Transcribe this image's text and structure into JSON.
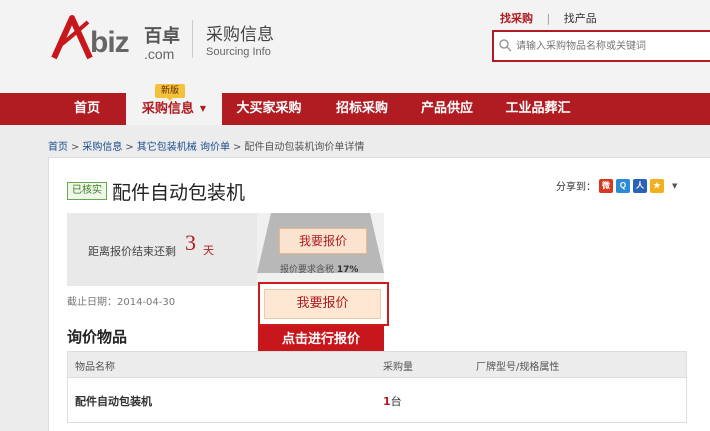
{
  "header": {
    "logo_biz": "biz",
    "logo_cn": "百卓",
    "logo_com": ".com",
    "site_title": "采购信息",
    "site_subtitle": "Sourcing Info",
    "top_links": {
      "buy": "找采购",
      "sep": "|",
      "sell": "找产品"
    },
    "search": {
      "placeholder": "请输入采购物品名称或关键词"
    }
  },
  "nav": {
    "badge": "新版",
    "items": [
      {
        "label": "首页"
      },
      {
        "label": "采购信息"
      },
      {
        "label": "大买家采购"
      },
      {
        "label": "招标采购"
      },
      {
        "label": "产品供应"
      },
      {
        "label": "工业品葬汇"
      }
    ],
    "active_caret": "▼"
  },
  "breadcrumb": {
    "items": [
      "首页",
      "采购信息",
      "其它包装机械 询价单"
    ],
    "separator": ">",
    "current": "配件自动包装机询价单详情"
  },
  "inquiry": {
    "verified_badge": "已核实",
    "title": "配件自动包装机",
    "share_label": "分享到：",
    "share_caret": "▼",
    "countdown_label": "距离报价结束还剩",
    "countdown_value": "3",
    "countdown_unit": "天",
    "quote_button": "我要报价",
    "tax_label": "报价要求含税",
    "tax_value": "17%",
    "deadline": "截止日期：2014-04-30",
    "highlight_button": "我要报价",
    "hint": "点击进行报价"
  },
  "items_section": {
    "title": "询价物品",
    "columns": [
      "物品名称",
      "采购量",
      "厂牌型号/规格属性"
    ],
    "rows": [
      {
        "name": "配件自动包装机",
        "qty_num": "1",
        "qty_unit": "台",
        "spec": ""
      }
    ]
  },
  "colors": {
    "brand_red": "#b01c22",
    "verified_green": "#3d7a23"
  }
}
